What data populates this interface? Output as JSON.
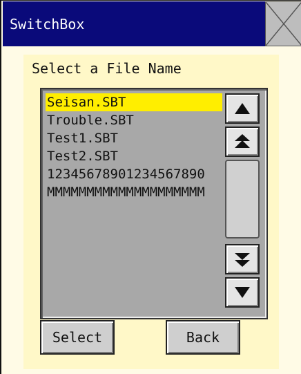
{
  "window": {
    "title": "SwitchBox",
    "close_icon": "close-x-icon"
  },
  "dialog": {
    "prompt": "Select a File Name",
    "files": [
      "Seisan.SBT",
      "Trouble.SBT",
      "Test1.SBT",
      "Test2.SBT",
      "12345678901234567890",
      "MMMMMMMMMMMMMMMMMMMM"
    ],
    "selected_index": 0,
    "scroll_icons": {
      "up": "triangle-up-icon",
      "page_up": "double-triangle-up-icon",
      "page_down": "double-triangle-down-icon",
      "down": "triangle-down-icon"
    },
    "buttons": {
      "select": "Select",
      "back": "Back"
    }
  },
  "colors": {
    "titlebar": "#0a0a7a",
    "background": "#fffbe6",
    "panel": "#fff8c8",
    "list_background": "#a8a8a8",
    "selection": "#ffee00"
  }
}
